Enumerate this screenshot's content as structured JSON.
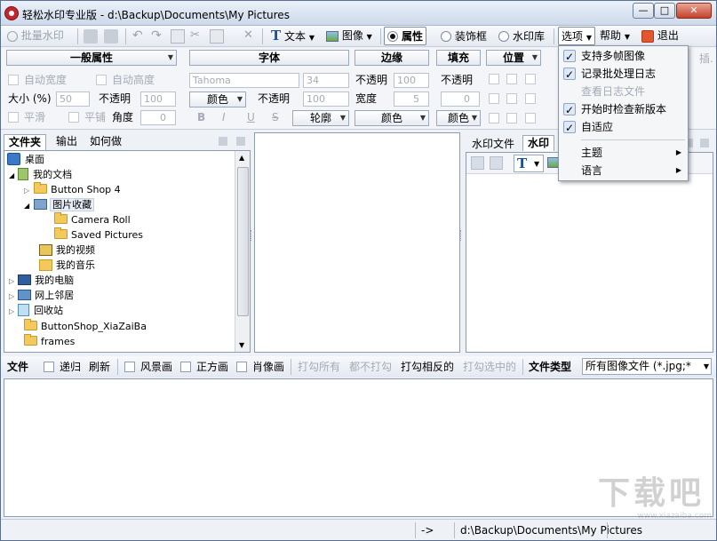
{
  "window": {
    "title": "轻松水印专业版 - d:\\Backup\\Documents\\My Pictures",
    "min_glyph": "—",
    "max_glyph": "□",
    "close_glyph": "✕"
  },
  "toolbar": {
    "batch_label": "批量水印",
    "text_label": "文本",
    "image_label": "图像",
    "props_label": "属性",
    "frame_label": "装饰框",
    "wmlib_label": "水印库",
    "options_label": "选项",
    "help_label": "帮助",
    "exit_label": "退出"
  },
  "props": {
    "headers": {
      "general": "一般属性",
      "font": "字体",
      "border": "边缘",
      "fill": "填充",
      "position": "位置",
      "overflow": "插."
    },
    "auto_width": "自动宽度",
    "auto_height": "自动高度",
    "size_label": "大小 (%)",
    "size_value": "50",
    "opacity_label": "不透明",
    "opacity_value": "100",
    "smooth": "平滑",
    "tile": "平铺",
    "angle_label": "角度",
    "angle_value": "0",
    "font_name": "Tahoma",
    "font_size": "34",
    "color_label": "颜色",
    "font_opacity_label": "不透明",
    "font_opacity_value": "100",
    "bold": "B",
    "italic": "I",
    "underline": "U",
    "strike": "S",
    "outline_label": "轮廓",
    "border_opacity_label": "不透明",
    "border_opacity_value": "100",
    "border_width_label": "宽度",
    "border_width_value": "5",
    "border_color_label": "颜色",
    "fill_opacity_label": "不透明",
    "fill_value": "0",
    "fill_color_label": "颜色"
  },
  "left_pane": {
    "tabs": [
      "文件夹",
      "输出",
      "如何做"
    ],
    "tree": [
      {
        "label": "桌面"
      },
      {
        "label": "我的文档"
      },
      {
        "label": "Button Shop 4"
      },
      {
        "label": "图片收藏"
      },
      {
        "label": "Camera Roll"
      },
      {
        "label": "Saved Pictures"
      },
      {
        "label": "我的视频"
      },
      {
        "label": "我的音乐"
      },
      {
        "label": "我的电脑"
      },
      {
        "label": "网上邻居"
      },
      {
        "label": "回收站"
      },
      {
        "label": "ButtonShop_XiaZaiBa"
      },
      {
        "label": "frames"
      }
    ]
  },
  "right_pane": {
    "tabs": [
      "水印文件",
      "水印"
    ]
  },
  "file_bar": {
    "files_label": "文件",
    "recursive": "递归",
    "refresh": "刷新",
    "landscape": "风景画",
    "square": "正方画",
    "portrait": "肖像画",
    "check_all": "打勾所有",
    "uncheck_all": "都不打勾",
    "invert": "打勾相反的",
    "check_selected": "打勾选中的",
    "file_type_label": "文件类型",
    "file_type_value": "所有图像文件 (*.jpg;*"
  },
  "menu": {
    "items": [
      {
        "label": "支持多帧图像",
        "checked": "✓"
      },
      {
        "label": "记录批处理日志",
        "checked": "✓"
      },
      {
        "label": "查看日志文件",
        "checked": ""
      },
      {
        "label": "开始时检查新版本",
        "checked": "✓"
      },
      {
        "label": "自适应",
        "checked": "✓"
      },
      {
        "label": "主题",
        "submenu": "▶"
      },
      {
        "label": "语言",
        "submenu": "▶"
      }
    ]
  },
  "status": {
    "arrow": "->",
    "path": "d:\\Backup\\Documents\\My Pictures"
  },
  "watermark_text": "下载吧",
  "watermark_url": "www.xiazaiba.com"
}
